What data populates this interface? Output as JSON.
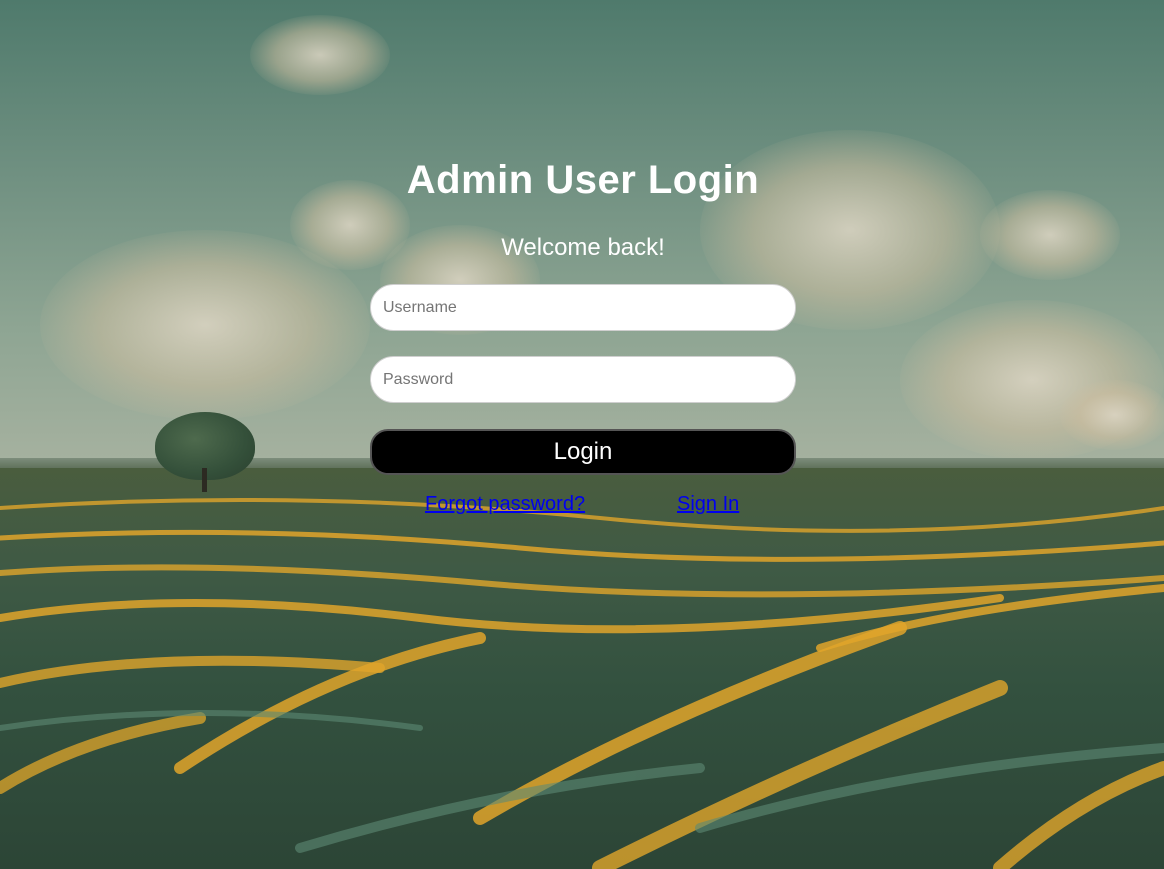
{
  "header": {
    "title": "Admin User Login",
    "subtitle": "Welcome back!"
  },
  "form": {
    "username": {
      "value": "",
      "placeholder": "Username"
    },
    "password": {
      "value": "",
      "placeholder": "Password"
    },
    "login_label": "Login"
  },
  "links": {
    "forgot_password": "Forgot password?",
    "sign_in": "Sign In"
  },
  "colors": {
    "title_text": "#ffffff",
    "button_bg": "#000000",
    "link": "#0000ee"
  }
}
